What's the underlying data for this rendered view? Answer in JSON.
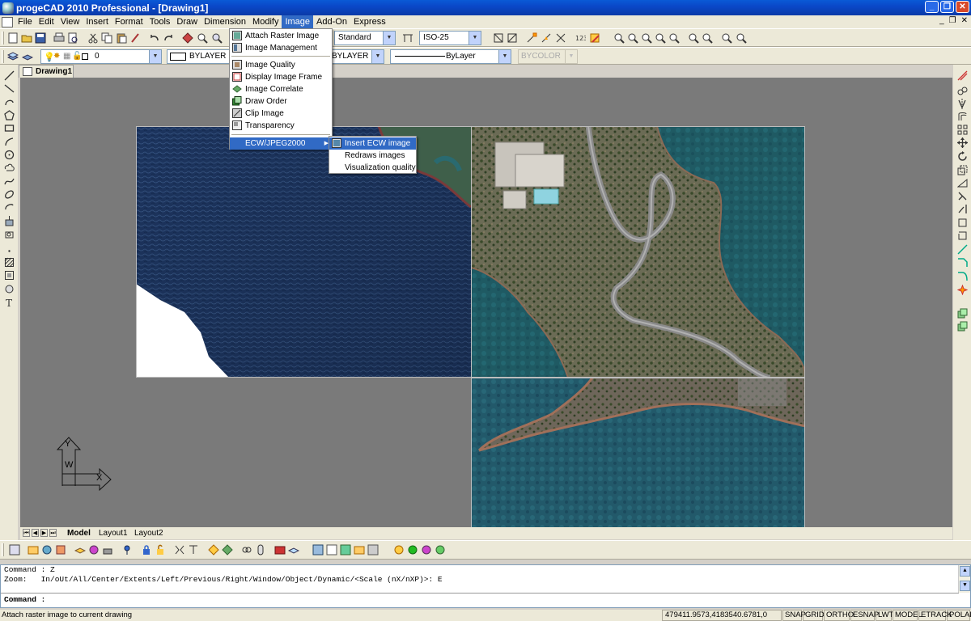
{
  "window": {
    "title": "progeCAD 2010 Professional - [Drawing1]"
  },
  "menu": [
    "File",
    "Edit",
    "View",
    "Insert",
    "Format",
    "Tools",
    "Draw",
    "Dimension",
    "Modify",
    "Image",
    "Add-On",
    "Express"
  ],
  "active_menu_index": 9,
  "image_menu": {
    "items": [
      {
        "label": "Attach Raster Image",
        "icon": "attach-raster-icon"
      },
      {
        "label": "Image Management",
        "icon": "image-management-icon"
      },
      {
        "label": "Image Quality",
        "icon": "image-quality-icon"
      },
      {
        "label": "Display Image Frame",
        "icon": "image-frame-icon"
      },
      {
        "label": "Image Correlate",
        "icon": "image-correlate-icon"
      },
      {
        "label": "Draw Order",
        "icon": "draw-order-icon"
      },
      {
        "label": "Clip Image",
        "icon": "clip-image-icon"
      },
      {
        "label": "Transparency",
        "icon": "transparency-icon"
      }
    ],
    "submenu_label": "ECW/JPEG2000",
    "submenu_arrow": "▶",
    "submenu_items": [
      "Insert ECW image",
      "Redraws images",
      "Visualization quality"
    ]
  },
  "toolbar": {
    "text_style": "Standard",
    "dim_style": "ISO-25",
    "layer": "0",
    "color": "BYLAYER",
    "linetype": "BYLAYER",
    "lineweight": "ByLayer",
    "plotstyle": "BYCOLOR"
  },
  "document_tab": "Drawing1",
  "layout_tabs": [
    "Model",
    "Layout1",
    "Layout2"
  ],
  "ucs": {
    "y": "Y",
    "x": "X",
    "w": "W"
  },
  "command": {
    "history": [
      "Command : Z",
      "Zoom:   In/oUt/All/Center/Extents/Left/Previous/Right/Window/Object/Dynamic/<Scale (nX/nXP)>: E"
    ],
    "prompt": "Command :",
    "input_value": ""
  },
  "status": {
    "message": "Attach raster image to current drawing",
    "coordinates": "479411.9573,4183540.6781,0",
    "toggles": [
      "SNAP",
      "GRID",
      "ORTHO",
      "ESNAP",
      "LWT",
      "MODEL",
      "ETRACK",
      "POLAR"
    ]
  },
  "colors": {
    "title_bar": "#0a48c8",
    "menu_highlight": "#316ac5",
    "canvas": "#7a7a7a",
    "ui_face": "#ece9d8"
  }
}
